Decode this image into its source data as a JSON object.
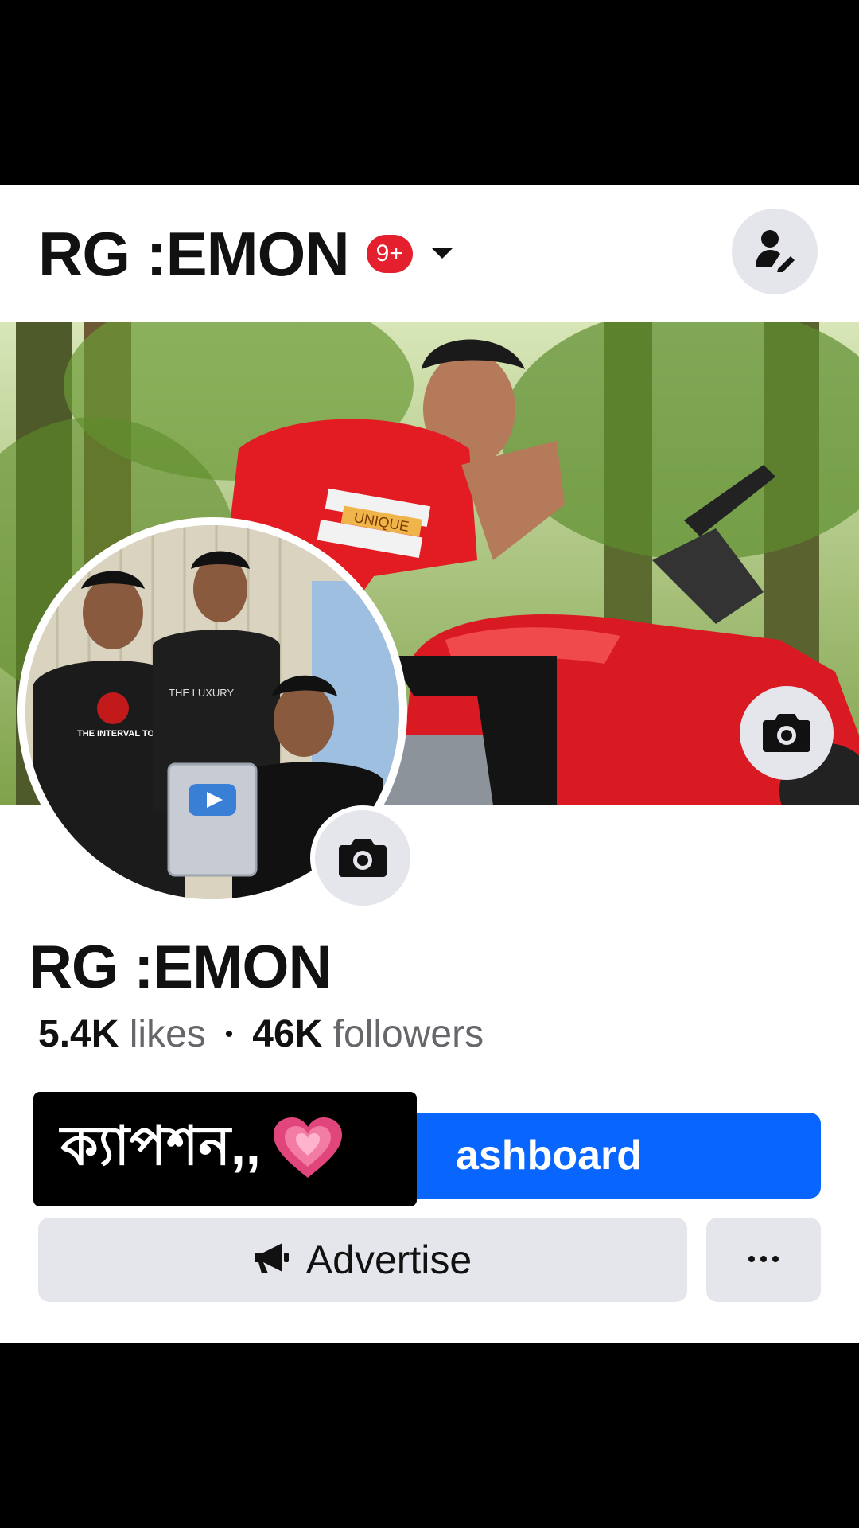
{
  "header": {
    "page_name": "RG :EMON",
    "notification_badge": "9+"
  },
  "profile": {
    "name": "RG :EMON",
    "likes_count": "5.4K",
    "likes_label": "likes",
    "separator": "•",
    "followers_count": "46K",
    "followers_label": "followers"
  },
  "actions": {
    "dashboard_label": "ashboard",
    "advertise_label": "Advertise",
    "more_label": "···"
  },
  "caption_overlay": {
    "text": "ক্যাপশন,,"
  },
  "cover_photo": {
    "shirt_text": "UNIQUE"
  },
  "profile_photo": {
    "shirt_logo_text": "THE INTERVAL TOURS",
    "shirt_text_2": "THE LUXURY"
  },
  "colors": {
    "primary_blue": "#0866ff",
    "badge_red": "#e4202e",
    "button_gray": "#e4e6eb",
    "overlay_black": "#000000"
  },
  "icons": {
    "profile_switch": "person-edit-icon",
    "camera": "camera-icon",
    "dropdown": "caret-down-icon",
    "advertise": "megaphone-icon",
    "more": "more-horizontal-icon",
    "heart": "heart-icon"
  }
}
